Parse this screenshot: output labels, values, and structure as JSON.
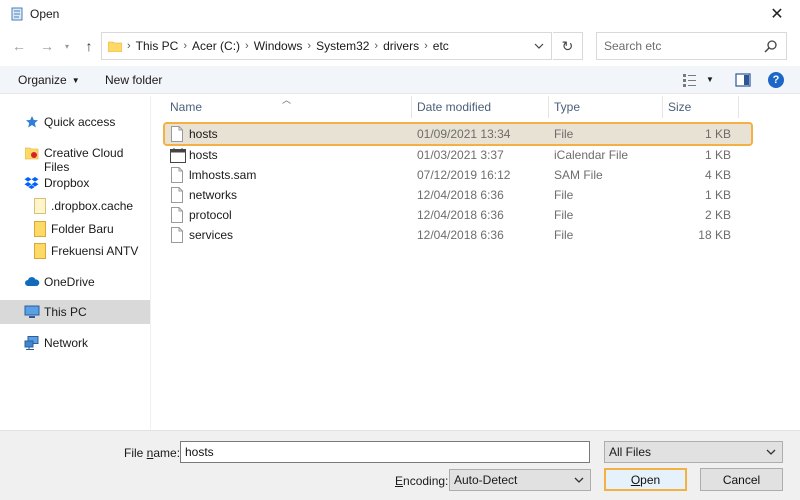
{
  "window": {
    "title": "Open"
  },
  "address": {
    "crumbs": [
      "This PC",
      "Acer (C:)",
      "Windows",
      "System32",
      "drivers",
      "etc"
    ]
  },
  "search": {
    "placeholder": "Search etc"
  },
  "toolbar": {
    "organize": "Organize",
    "new_folder": "New folder"
  },
  "sidebar": {
    "items": [
      {
        "label": "Quick access",
        "icon": "star-icon"
      },
      {
        "label": "Creative Cloud Files",
        "icon": "creative-cloud-folder-icon"
      },
      {
        "label": "Dropbox",
        "icon": "dropbox-icon"
      },
      {
        "label": ".dropbox.cache",
        "icon": "folder-icon"
      },
      {
        "label": "Folder Baru",
        "icon": "folder-icon"
      },
      {
        "label": "Frekuensi ANTV",
        "icon": "folder-icon"
      },
      {
        "label": "OneDrive",
        "icon": "cloud-icon"
      },
      {
        "label": "This PC",
        "icon": "computer-icon",
        "selected": true
      },
      {
        "label": "Network",
        "icon": "network-icon"
      }
    ]
  },
  "columns": {
    "name": "Name",
    "date": "Date modified",
    "type": "Type",
    "size": "Size"
  },
  "files": [
    {
      "name": "hosts",
      "date": "01/09/2021 13:34",
      "type": "File",
      "size": "1 KB",
      "icon": "document-icon",
      "selected": true
    },
    {
      "name": "hosts",
      "date": "01/03/2021 3:37",
      "type": "iCalendar File",
      "size": "1 KB",
      "icon": "calendar-icon"
    },
    {
      "name": "lmhosts.sam",
      "date": "07/12/2019 16:12",
      "type": "SAM File",
      "size": "4 KB",
      "icon": "document-icon"
    },
    {
      "name": "networks",
      "date": "12/04/2018 6:36",
      "type": "File",
      "size": "1 KB",
      "icon": "document-icon"
    },
    {
      "name": "protocol",
      "date": "12/04/2018 6:36",
      "type": "File",
      "size": "2 KB",
      "icon": "document-icon"
    },
    {
      "name": "services",
      "date": "12/04/2018 6:36",
      "type": "File",
      "size": "18 KB",
      "icon": "document-icon"
    }
  ],
  "footer": {
    "file_name_label_pre": "File ",
    "file_name_label_u": "n",
    "file_name_label_post": "ame:",
    "file_name_value": "hosts",
    "filter_value": "All Files",
    "encoding_label_u": "E",
    "encoding_label_post": "ncoding:",
    "encoding_value": "Auto-Detect",
    "open_u": "O",
    "open_post": "pen",
    "cancel": "Cancel"
  },
  "colors": {
    "accent": "#f4b043",
    "selection": "#e8e2d4",
    "toolbar_bg": "#f2f5fa",
    "sidebar_selected": "#d9d9d9",
    "help_blue": "#1d67c7",
    "folder_yellow": "#ffd966"
  }
}
